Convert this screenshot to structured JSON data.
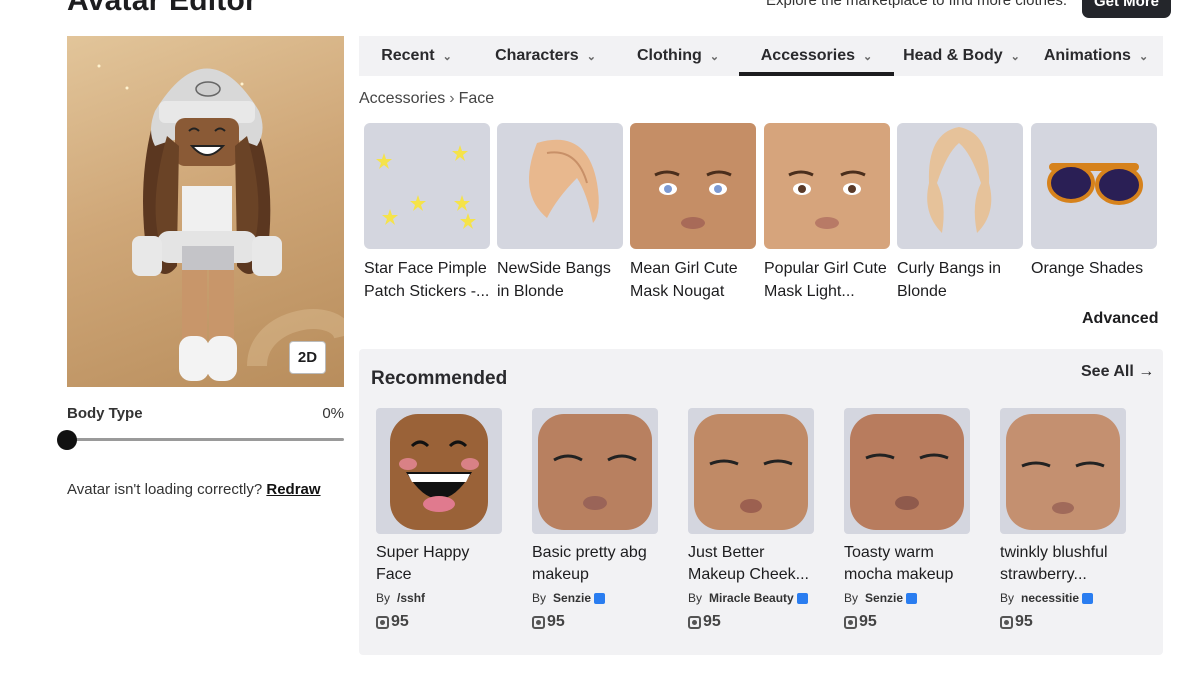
{
  "header": {
    "title": "Avatar Editor",
    "marketing_text": "Explore the marketplace to find more clothes.",
    "get_more_label": "Get More"
  },
  "avatar": {
    "view_toggle_label": "2D",
    "body_type_label": "Body Type",
    "body_type_value": "0%",
    "body_type_fraction": 0,
    "loading_help_text": "Avatar isn't loading correctly?",
    "redraw_label": "Redraw"
  },
  "tabs": [
    {
      "label": "Recent"
    },
    {
      "label": "Characters"
    },
    {
      "label": "Clothing"
    },
    {
      "label": "Accessories",
      "active": true
    },
    {
      "label": "Head & Body"
    },
    {
      "label": "Animations"
    }
  ],
  "breadcrumb": {
    "parent": "Accessories",
    "current": "Face"
  },
  "items": [
    {
      "name": "Star Face Pimple Patch Stickers -...",
      "icon": "stars"
    },
    {
      "name": "NewSide Bangs in Blonde",
      "icon": "bangs"
    },
    {
      "name": "Mean Girl Cute Mask Nougat",
      "icon": "face-blue-eyes"
    },
    {
      "name": "Popular Girl Cute Mask Light...",
      "icon": "face-brown-eyes"
    },
    {
      "name": "Curly Bangs in Blonde",
      "icon": "curly-hair"
    },
    {
      "name": "Orange Shades",
      "icon": "sunglasses"
    }
  ],
  "advanced_label": "Advanced",
  "recommended": {
    "title": "Recommended",
    "see_all_label": "See All",
    "items": [
      {
        "name": "Super Happy Face",
        "by": "By",
        "creator": "/sshf",
        "verified": false,
        "price": "95"
      },
      {
        "name": "Basic pretty abg makeup",
        "by": "By",
        "creator": "Senzie",
        "verified": true,
        "price": "95"
      },
      {
        "name": "Just Better Makeup Cheek...",
        "by": "By",
        "creator": "Miracle Beauty",
        "verified": true,
        "price": "95"
      },
      {
        "name": "Toasty warm mocha makeup",
        "by": "By",
        "creator": "Senzie",
        "verified": true,
        "price": "95"
      },
      {
        "name": "twinkly blushful strawberry...",
        "by": "By",
        "creator": "necessitie",
        "verified": true,
        "price": "95"
      }
    ]
  },
  "colors": {
    "accent": "#1d1d1f",
    "verified": "#2a7df0",
    "panel_bg": "#f2f2f4",
    "thumb_bg": "#d4d6df"
  }
}
